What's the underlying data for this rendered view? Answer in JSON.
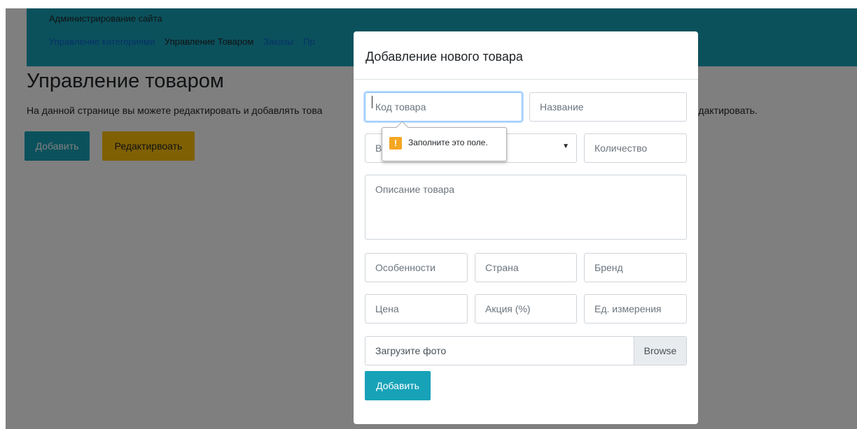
{
  "admin": {
    "title": "Администрирование сайта",
    "nav": [
      "Управление категориями",
      "Управление Товаром",
      "Заказы",
      "Пр"
    ]
  },
  "page": {
    "heading": "Управление товаром",
    "description": "На данной странице вы можете редактировать и добавлять това",
    "description_tail": "ктирования - редактировать.",
    "add_button": "Добавить",
    "edit_button": "Редактирвоать"
  },
  "modal": {
    "title": "Добавление нового товара",
    "fields": {
      "code_placeholder": "Код товара",
      "name_placeholder": "Название",
      "select_value": "В",
      "quantity_placeholder": "Количество",
      "description_placeholder": "Описание товара",
      "features_placeholder": "Особенности",
      "country_placeholder": "Страна",
      "brand_placeholder": "Бренд",
      "price_placeholder": "Цена",
      "discount_placeholder": "Акция (%)",
      "unit_placeholder": "Ед. измерения"
    },
    "file": {
      "label": "Загрузите фото",
      "browse": "Browse"
    },
    "submit_label": "Добавить",
    "validation_tooltip": "Заполните это поле.",
    "validation_icon": "!"
  },
  "colors": {
    "accent": "#17a2b8",
    "warning": "#ffc107",
    "link": "#0b63d1",
    "tooltip_icon": "#f5a623"
  }
}
